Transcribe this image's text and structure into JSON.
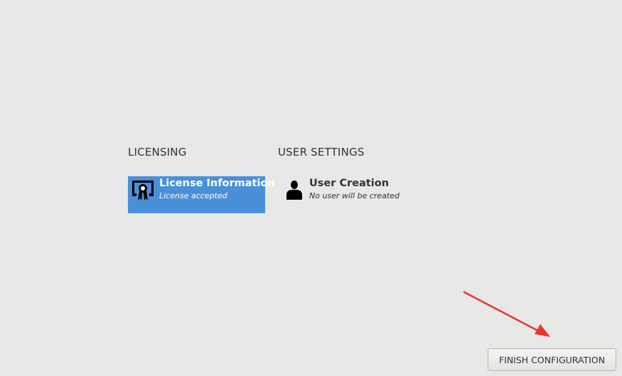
{
  "hub": {
    "sections": [
      {
        "title": "LICENSING",
        "spokes": [
          {
            "title": "License Information",
            "status": "License accepted",
            "icon": "license-certificate-icon",
            "selected": true
          }
        ]
      },
      {
        "title": "USER SETTINGS",
        "spokes": [
          {
            "title": "User Creation",
            "status": "No user will be created",
            "icon": "user-icon",
            "selected": false
          }
        ]
      }
    ],
    "finish_button_label": "FINISH CONFIGURATION"
  },
  "colors": {
    "background": "#e8e8e7",
    "selected_spoke": "#4a90d9",
    "annotation_arrow": "#e8382f"
  }
}
